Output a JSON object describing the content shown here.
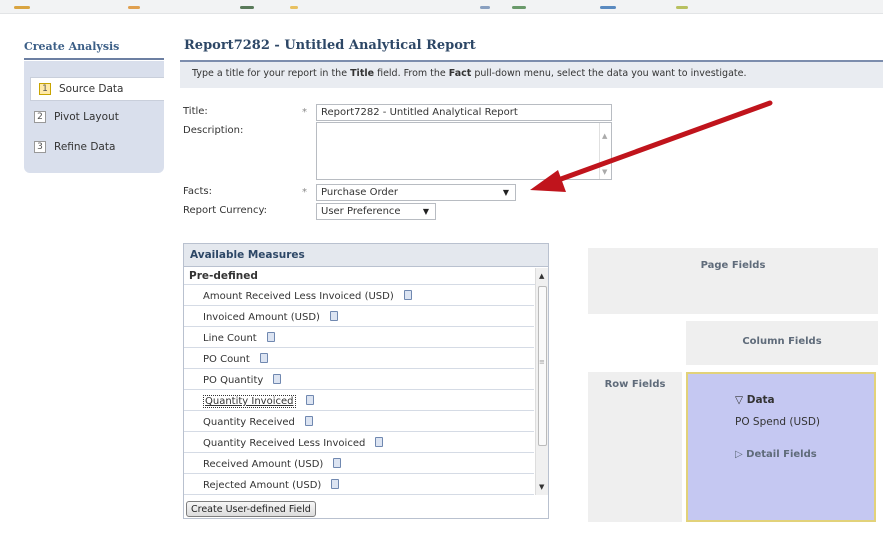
{
  "sidebar": {
    "title": "Create Analysis",
    "steps": [
      {
        "num": "1",
        "label": "Source Data"
      },
      {
        "num": "2",
        "label": "Pivot Layout"
      },
      {
        "num": "3",
        "label": "Refine Data"
      }
    ]
  },
  "page": {
    "title": "Report7282 - Untitled Analytical Report",
    "instructions": {
      "part1": "Type a title for your report in the ",
      "bold1": "Title",
      "part2": " field. From the ",
      "bold2": "Fact",
      "part3": " pull-down menu, select the data you want to investigate."
    }
  },
  "form": {
    "title_label": "Title:",
    "title_value": "Report7282 - Untitled Analytical Report",
    "description_label": "Description:",
    "description_value": "",
    "facts_label": "Facts:",
    "facts_value": "Purchase Order",
    "currency_label": "Report Currency:",
    "currency_value": "User Preference",
    "required_mark": "*"
  },
  "measures": {
    "header": "Available Measures",
    "group": "Pre-defined",
    "items": [
      "Amount Received Less Invoiced (USD)",
      "Invoiced Amount (USD)",
      "Line Count",
      "PO Count",
      "PO Quantity",
      "Quantity Invoiced",
      "Quantity Received",
      "Quantity Received Less Invoiced",
      "Received Amount (USD)",
      "Rejected Amount (USD)"
    ],
    "create_button": "Create User-defined Field"
  },
  "layout_zones": {
    "page_fields": "Page Fields",
    "column_fields": "Column Fields",
    "row_fields": "Row Fields",
    "data_title": "Data",
    "data_item": "PO Spend (USD)",
    "detail_fields": "Detail Fields"
  },
  "colors": {
    "annotation_arrow": "#c0141c",
    "data_zone": "#c5c8f2",
    "title_blue": "#2d4766"
  }
}
